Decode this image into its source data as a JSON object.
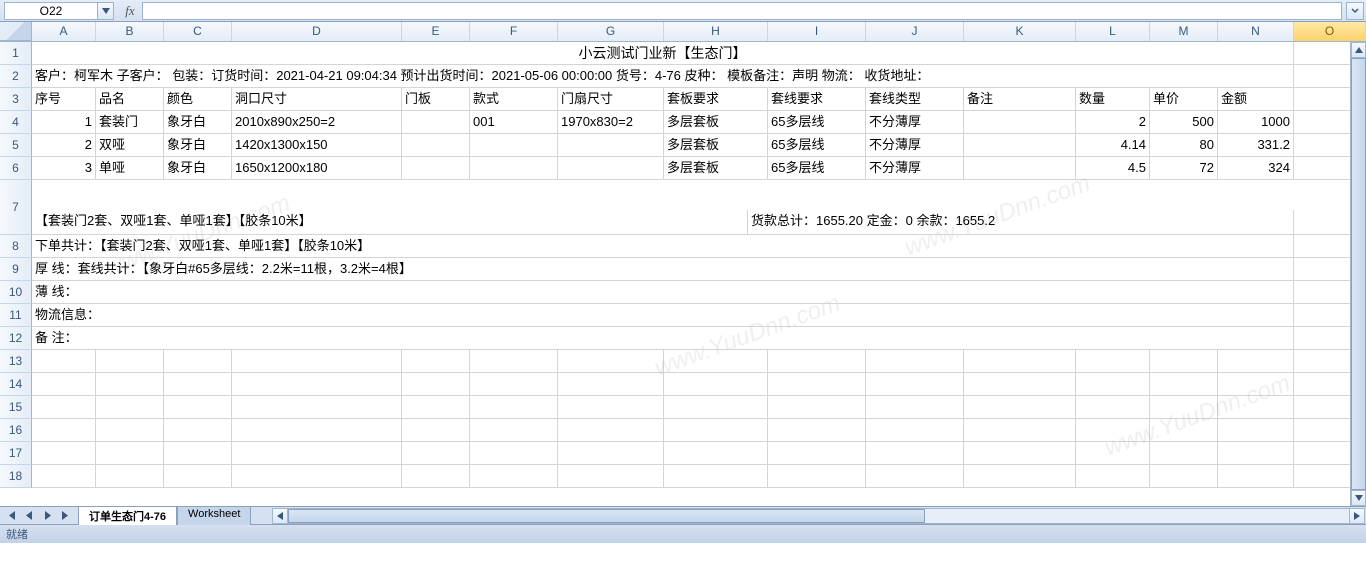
{
  "nameBox": "O22",
  "fxLabel": "fx",
  "formulaValue": "",
  "columns": [
    "A",
    "B",
    "C",
    "D",
    "E",
    "F",
    "G",
    "H",
    "I",
    "J",
    "K",
    "L",
    "M",
    "N",
    "O"
  ],
  "selectedCol": "O",
  "title": "小云测试门业新【生态门】",
  "row2": "客户：柯军木 子客户：    包装：订货时间：2021-04-21 09:04:34 预计出货时间：2021-05-06 00:00:00 货号：4-76 皮种：  模板备注：声明 物流：  收货地址：",
  "headers": {
    "A": "序号",
    "B": "品名",
    "C": "颜色",
    "D": "洞口尺寸",
    "E": "门板",
    "F": "款式",
    "G": "门扇尺寸",
    "H": "套板要求",
    "I": "套线要求",
    "J": "套线类型",
    "K": "备注",
    "L": "数量",
    "M": "单价",
    "N": "金额"
  },
  "dataRows": [
    {
      "A": "1",
      "B": "套装门",
      "C": "象牙白",
      "D": "2010x890x250=2",
      "E": "",
      "F": "001",
      "G": "1970x830=2",
      "H": "多层套板",
      "I": "65多层线",
      "J": "不分薄厚",
      "K": "",
      "L": "2",
      "M": "500",
      "N": "1000"
    },
    {
      "A": "2",
      "B": "双哑",
      "C": "象牙白",
      "D": "1420x1300x150",
      "E": "",
      "F": "",
      "G": "",
      "H": "多层套板",
      "I": "65多层线",
      "J": "不分薄厚",
      "K": "",
      "L": "4.14",
      "M": "80",
      "N": "331.2"
    },
    {
      "A": "3",
      "B": "单哑",
      "C": "象牙白",
      "D": "1650x1200x180",
      "E": "",
      "F": "",
      "G": "",
      "H": "多层套板",
      "I": "65多层线",
      "J": "不分薄厚",
      "K": "",
      "L": "4.5",
      "M": "72",
      "N": "324"
    }
  ],
  "row7_left": "【套装门2套、双哑1套、单哑1套】【胶条10米】",
  "row7_right": "货款总计：1655.20  定金：0 余款：1655.2",
  "row8": "下单共计：【套装门2套、双哑1套、单哑1套】【胶条10米】",
  "row9": "厚      线：套线共计：【象牙白#65多层线：2.2米=11根，3.2米=4根】",
  "row10": "薄      线：",
  "row11": "物流信息：",
  "row12": "备      注：",
  "tabs": {
    "active": "订单生态门4-76",
    "other": "Worksheet"
  },
  "status": "就绪",
  "watermark": "www.YuuDnn.com"
}
